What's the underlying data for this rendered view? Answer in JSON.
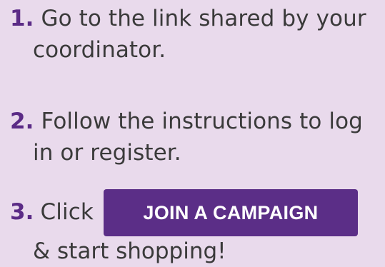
{
  "steps": [
    {
      "number": "1.",
      "line1": "Go to the link shared by your",
      "line2": "coordinator."
    },
    {
      "number": "2.",
      "line1": "Follow the instructions to log",
      "line2": "in or register."
    },
    {
      "number": "3.",
      "line1": "Click",
      "button_label": "JOIN A CAMPAIGN",
      "line2": "& start shopping!"
    }
  ],
  "colors": {
    "background": "#e9daec",
    "accent": "#5b2e87",
    "text": "#3a3a3a",
    "button_text": "#ffffff"
  }
}
